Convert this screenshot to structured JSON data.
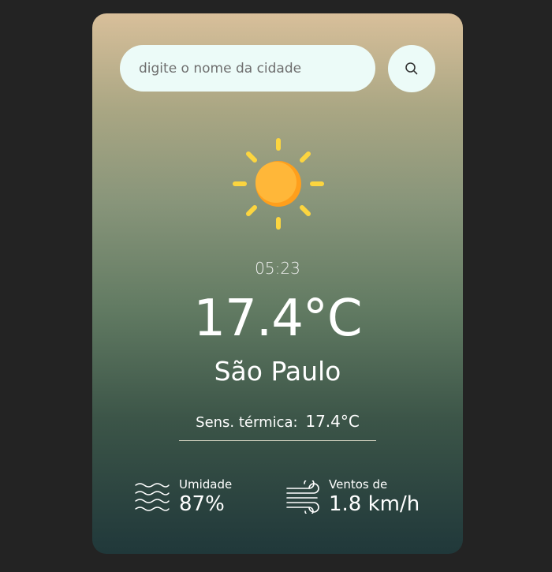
{
  "search": {
    "placeholder": "digite o nome da cidade",
    "value": ""
  },
  "weather": {
    "icon": "sun-icon",
    "time": "05:23",
    "temperature": "17.4°C",
    "city": "São Paulo",
    "feels_like_label": "Sens. térmica:",
    "feels_like_value": "17.4°C"
  },
  "stats": {
    "humidity": {
      "icon": "humidity-waves-icon",
      "label": "Umidade",
      "value": "87%"
    },
    "wind": {
      "icon": "wind-icon",
      "label": "Ventos de",
      "value": "1.8 km/h"
    }
  },
  "colors": {
    "background": "#232323",
    "card_top": "#d8bf9a",
    "card_bottom": "#20383a",
    "input_bg": "#ecfbf8",
    "sun_core": "#ffb02e",
    "sun_rays": "#fcd53f"
  }
}
